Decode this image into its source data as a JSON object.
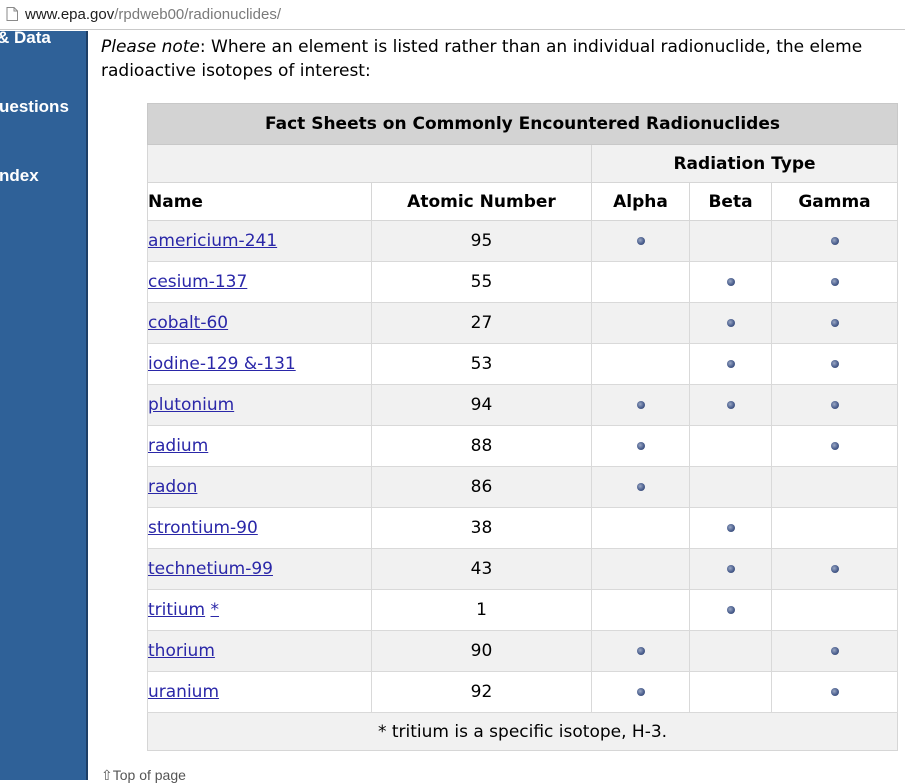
{
  "browser": {
    "url_domain": "www.epa.gov",
    "url_path": "/rpdweb00/radionuclides/"
  },
  "sidebar": {
    "items": [
      {
        "label": "& Data"
      },
      {
        "label": "uestions"
      },
      {
        "label": "ndex"
      }
    ]
  },
  "note": {
    "prefix": "Please note",
    "line1_rest": ": Where an element is listed rather than an individual radionuclide, the eleme",
    "line2": "radioactive isotopes of interest:"
  },
  "table": {
    "caption": "Fact Sheets on Commonly Encountered Radionuclides",
    "radiation_type_header": "Radiation Type",
    "col_name": "Name",
    "col_atomic": "Atomic Number",
    "col_alpha": "Alpha",
    "col_beta": "Beta",
    "col_gamma": "Gamma",
    "rows": [
      {
        "name": "americium-241",
        "atomic": "95",
        "alpha": true,
        "beta": false,
        "gamma": true
      },
      {
        "name": "cesium-137",
        "atomic": "55",
        "alpha": false,
        "beta": true,
        "gamma": true
      },
      {
        "name": "cobalt-60",
        "atomic": "27",
        "alpha": false,
        "beta": true,
        "gamma": true
      },
      {
        "name": "iodine-129 &-131",
        "atomic": "53",
        "alpha": false,
        "beta": true,
        "gamma": true
      },
      {
        "name": "plutonium",
        "atomic": "94",
        "alpha": true,
        "beta": true,
        "gamma": true
      },
      {
        "name": "radium",
        "atomic": "88",
        "alpha": true,
        "beta": false,
        "gamma": true
      },
      {
        "name": "radon",
        "atomic": "86",
        "alpha": true,
        "beta": false,
        "gamma": false
      },
      {
        "name": "strontium-90",
        "atomic": "38",
        "alpha": false,
        "beta": true,
        "gamma": false
      },
      {
        "name": "technetium-99",
        "atomic": "43",
        "alpha": false,
        "beta": true,
        "gamma": true
      },
      {
        "name": "tritium",
        "asterisk": "*",
        "atomic": "1",
        "alpha": false,
        "beta": true,
        "gamma": false
      },
      {
        "name": "thorium",
        "atomic": "90",
        "alpha": true,
        "beta": false,
        "gamma": true
      },
      {
        "name": "uranium",
        "atomic": "92",
        "alpha": true,
        "beta": false,
        "gamma": true
      }
    ],
    "footnote": "* tritium is a specific isotope, H-3."
  },
  "top_link": "Top of page",
  "colors": {
    "sidebar": "#2f6198",
    "link": "#2a27a8",
    "caption_bg": "#d3d3d3",
    "stripe_bg": "#f1f1f1"
  },
  "icons": {
    "page": "page-icon",
    "marker": "dot-icon",
    "top_arrow": "up-arrow-icon"
  }
}
